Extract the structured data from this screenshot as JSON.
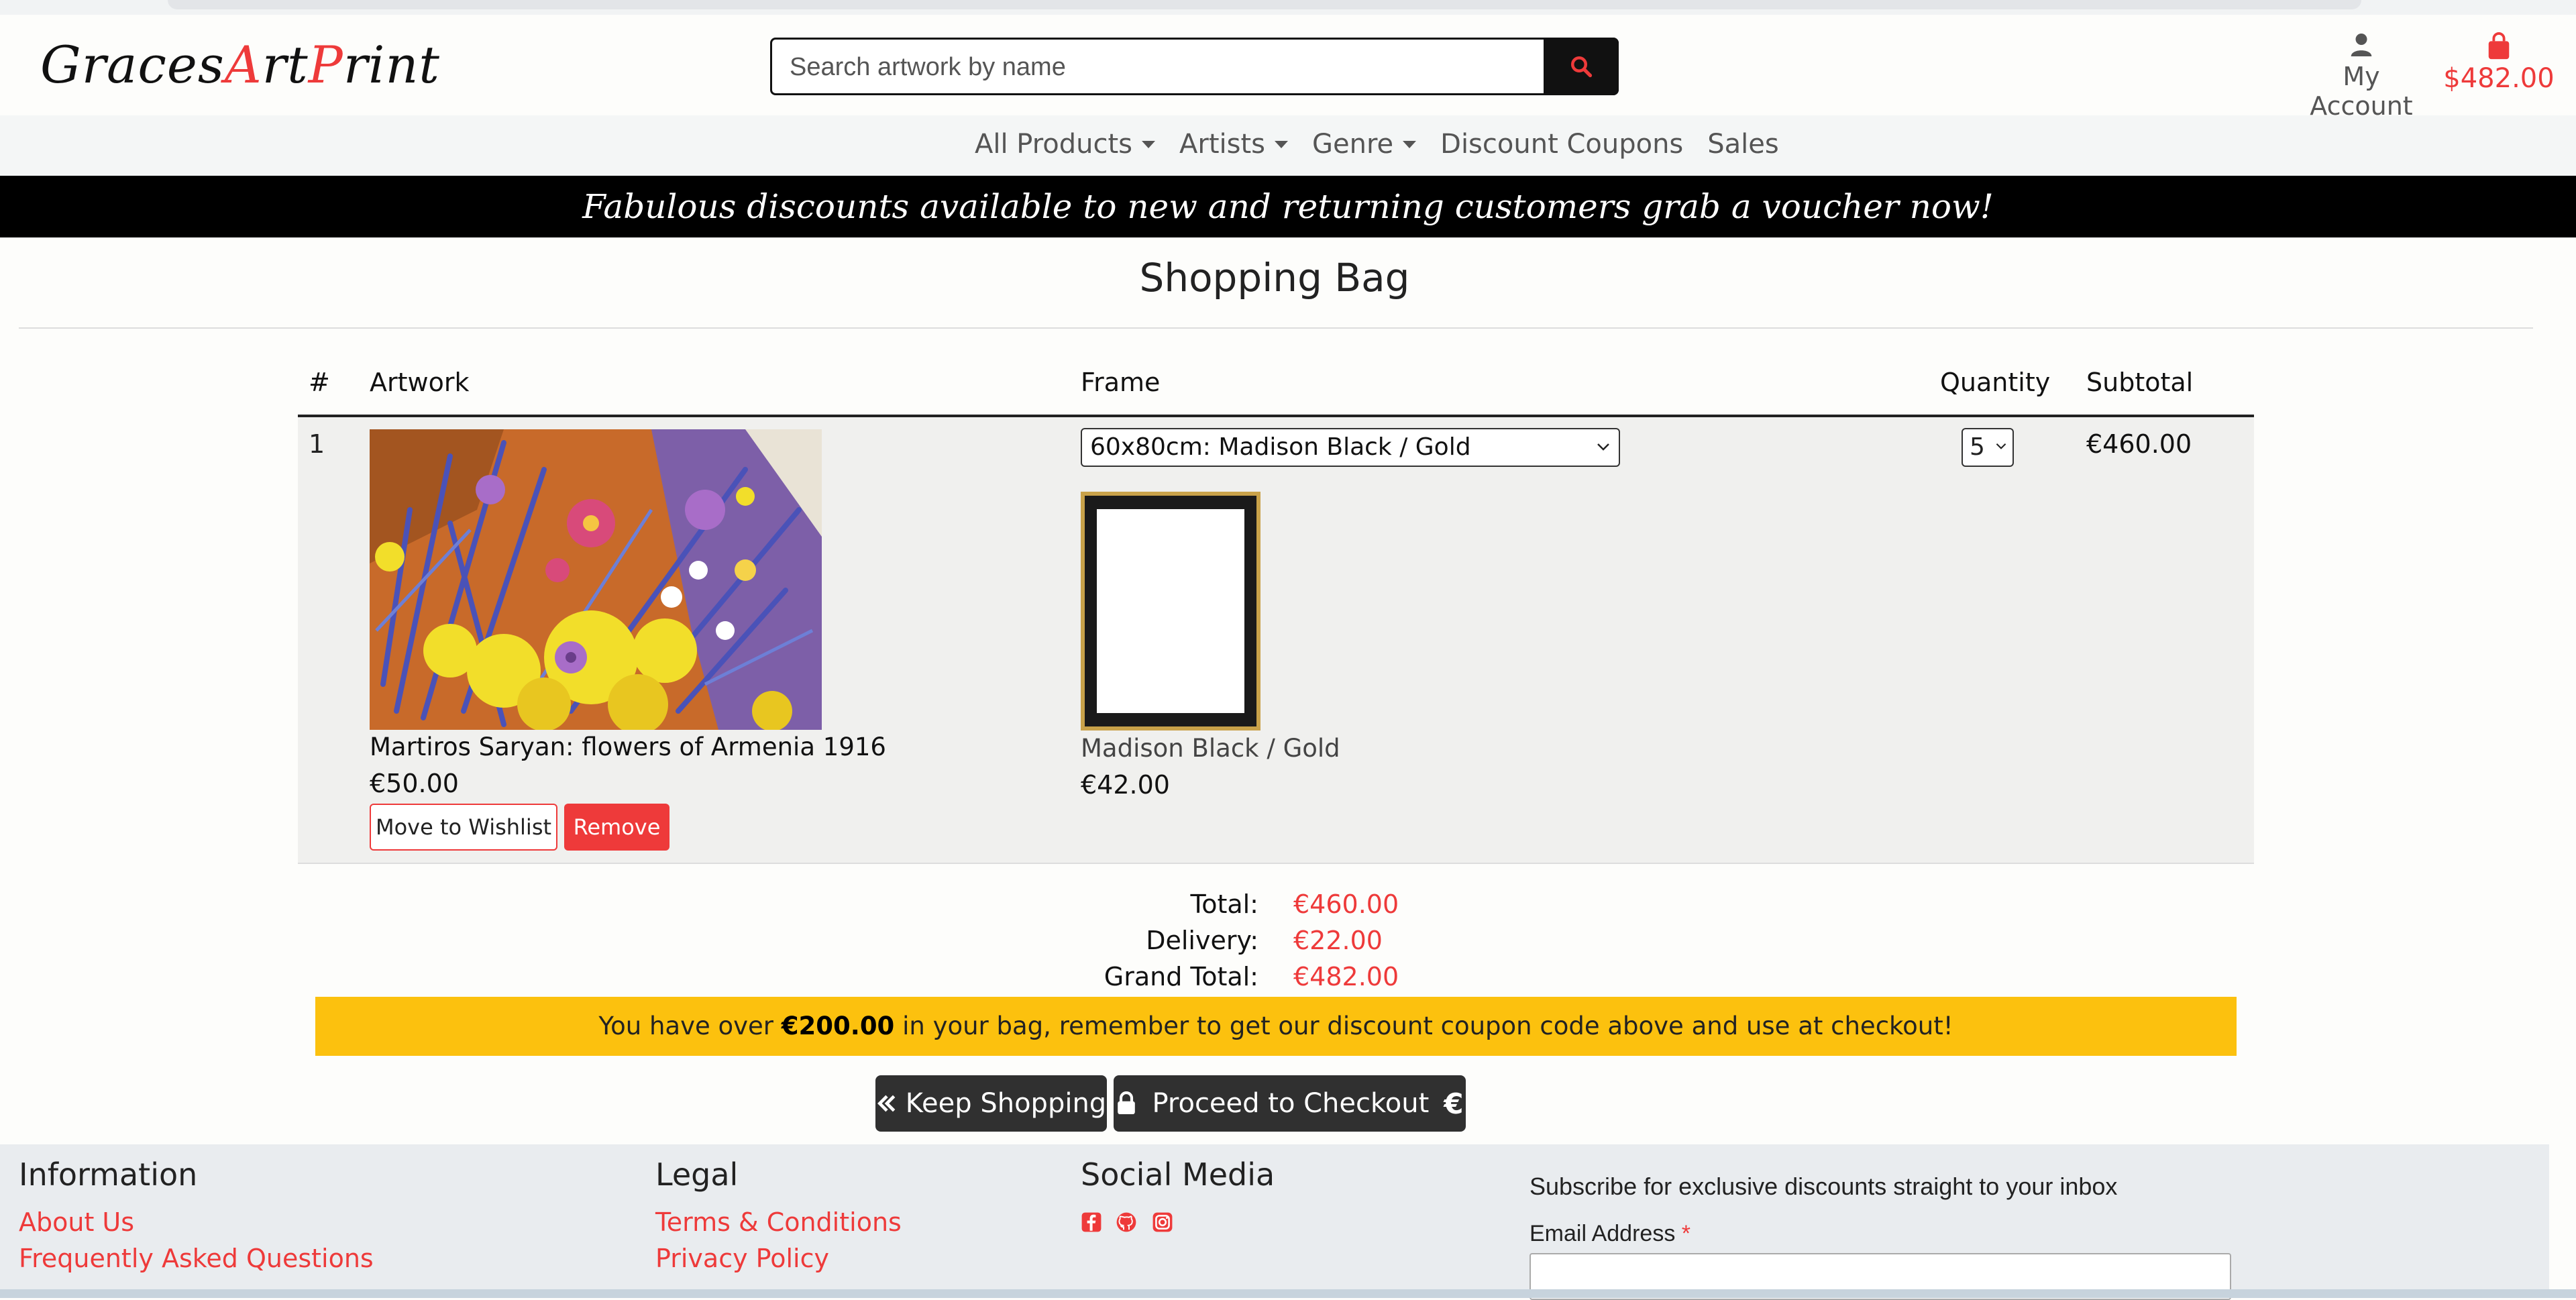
{
  "header": {
    "logo": {
      "part1": "Graces",
      "part2": "A",
      "part3": "rt",
      "part4": "P",
      "part5": "rint"
    },
    "search": {
      "placeholder": "Search artwork by name"
    },
    "account_label": "My Account",
    "bag_total": "$482.00"
  },
  "nav": {
    "items": [
      {
        "label": "All Products",
        "dropdown": true
      },
      {
        "label": "Artists",
        "dropdown": true
      },
      {
        "label": "Genre",
        "dropdown": true
      },
      {
        "label": "Discount Coupons",
        "dropdown": false
      },
      {
        "label": "Sales",
        "dropdown": false
      }
    ]
  },
  "banner": "Fabulous discounts available to new and returning customers grab a voucher now!",
  "page_title": "Shopping Bag",
  "table": {
    "headers": {
      "num": "#",
      "artwork": "Artwork",
      "frame": "Frame",
      "quantity": "Quantity",
      "subtotal": "Subtotal"
    },
    "row": {
      "num": "1",
      "artwork_title": "Martiros Saryan: flowers of Armenia 1916",
      "artwork_price": "€50.00",
      "wishlist_label": "Move to Wishlist",
      "remove_label": "Remove",
      "frame_option": "60x80cm: Madison Black / Gold",
      "frame_name": "Madison Black / Gold",
      "frame_price": "€42.00",
      "quantity": "5",
      "subtotal": "€460.00"
    }
  },
  "totals": {
    "total_label": "Total:",
    "total": "€460.00",
    "delivery_label": "Delivery:",
    "delivery": "€22.00",
    "grand_label": "Grand Total:",
    "grand": "€482.00"
  },
  "notice": {
    "before": "You have over ",
    "amount": "€200.00",
    "after": " in your bag, remember to get our discount coupon code above and use at checkout!"
  },
  "buttons": {
    "keep_shopping": "Keep Shopping",
    "checkout": "Proceed to Checkout"
  },
  "footer": {
    "info_heading": "Information",
    "info_links": [
      "About Us",
      "Frequently Asked Questions"
    ],
    "legal_heading": "Legal",
    "legal_links": [
      "Terms & Conditions",
      "Privacy Policy"
    ],
    "social_heading": "Social Media",
    "subscribe_text": "Subscribe for exclusive discounts straight to your inbox",
    "email_label": "Email Address",
    "email_required": "*"
  },
  "colors": {
    "accent": "#ee3a3a",
    "notice": "#fcc10e",
    "dark": "#303030",
    "frame_gold": "#c9a24a"
  },
  "icons": [
    "search-icon",
    "user-icon",
    "shopping-bag-icon",
    "chevron-down-icon",
    "double-chevron-left-icon",
    "lock-icon",
    "euro-icon",
    "facebook-icon",
    "github-icon",
    "instagram-icon"
  ]
}
